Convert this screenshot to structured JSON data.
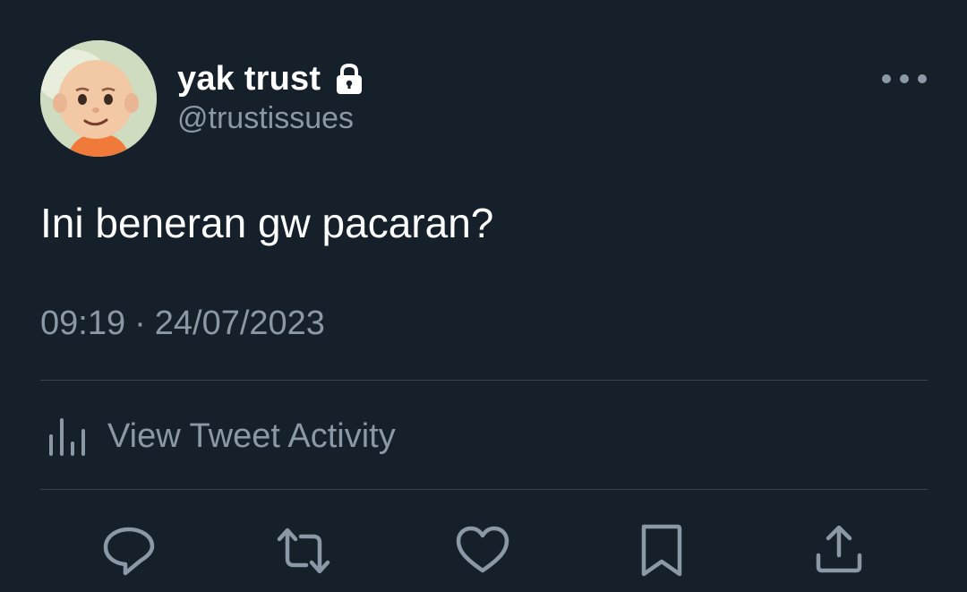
{
  "user": {
    "display_name": "yak trust",
    "handle": "@trustissues",
    "protected_icon": "lock-icon",
    "avatar": "avatar-cartoon-bald-boy"
  },
  "menu": {
    "icon": "more-horizontal-icon"
  },
  "tweet": {
    "text": "Ini beneran gw pacaran?",
    "time": "09:19",
    "separator": "·",
    "date": "24/07/2023"
  },
  "activity": {
    "icon": "bar-chart-icon",
    "label": "View Tweet Activity"
  },
  "actions": [
    {
      "icon": "reply-icon"
    },
    {
      "icon": "retweet-icon"
    },
    {
      "icon": "like-icon"
    },
    {
      "icon": "bookmark-icon"
    },
    {
      "icon": "share-icon"
    }
  ],
  "colors": {
    "background": "#15202b",
    "primary_text": "#ffffff",
    "secondary_text": "#8b98a5",
    "divider": "#38444d"
  }
}
